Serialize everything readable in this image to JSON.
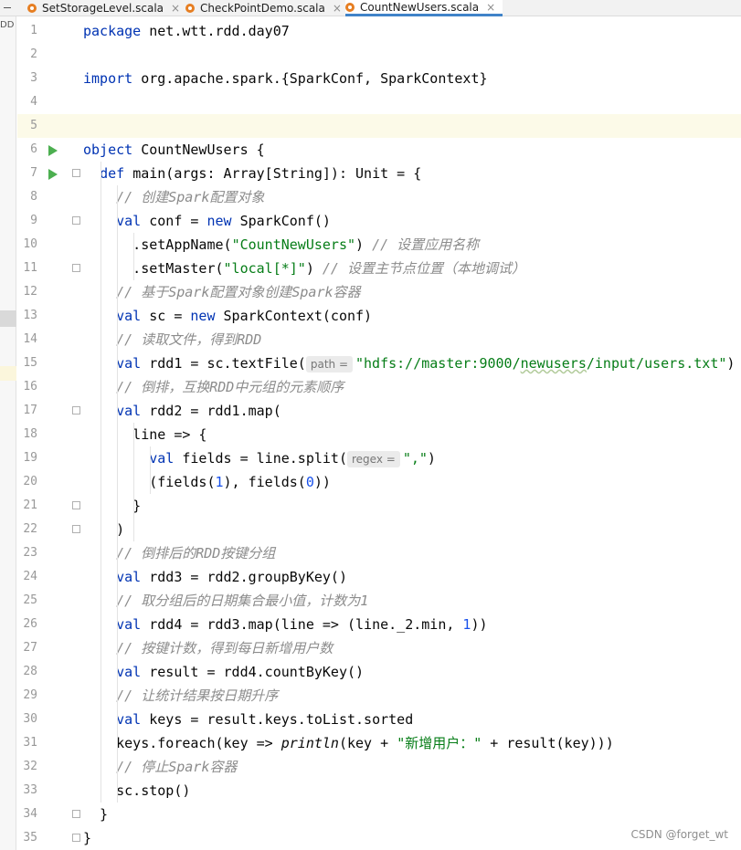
{
  "tabs": [
    {
      "label": "SetStorageLevel.scala",
      "active": false
    },
    {
      "label": "CheckPointDemo.scala",
      "active": false
    },
    {
      "label": "CountNewUsers.scala",
      "active": true
    }
  ],
  "tab_close_glyph": "×",
  "sidebar": {
    "label": "DD"
  },
  "editor": {
    "lines": [
      {
        "n": "1",
        "tokens": [
          {
            "t": "package ",
            "c": "kw"
          },
          {
            "t": "net.wtt.rdd.day07"
          }
        ]
      },
      {
        "n": "2",
        "tokens": []
      },
      {
        "n": "3",
        "tokens": [
          {
            "t": "import ",
            "c": "kw"
          },
          {
            "t": "org.apache.spark.{SparkConf, SparkContext}"
          }
        ]
      },
      {
        "n": "4",
        "tokens": []
      },
      {
        "n": "5",
        "tokens": [],
        "caret": true
      },
      {
        "n": "6",
        "run": true,
        "tokens": [
          {
            "t": "object ",
            "c": "kw"
          },
          {
            "t": "CountNewUsers {"
          }
        ]
      },
      {
        "n": "7",
        "run": true,
        "fold": true,
        "tokens": [
          {
            "t": "  "
          },
          {
            "t": "def ",
            "c": "kw"
          },
          {
            "t": "main(args: Array[String]): Unit = {"
          }
        ]
      },
      {
        "n": "8",
        "tokens": [
          {
            "t": "    "
          },
          {
            "t": "// 创建Spark配置对象",
            "c": "cmt"
          }
        ]
      },
      {
        "n": "9",
        "fold": true,
        "tokens": [
          {
            "t": "    "
          },
          {
            "t": "val ",
            "c": "kw"
          },
          {
            "t": "conf = "
          },
          {
            "t": "new ",
            "c": "kw"
          },
          {
            "t": "SparkConf()"
          }
        ]
      },
      {
        "n": "10",
        "tokens": [
          {
            "t": "      .setAppName("
          },
          {
            "t": "\"CountNewUsers\"",
            "c": "str"
          },
          {
            "t": ") "
          },
          {
            "t": "// 设置应用名称",
            "c": "cmt"
          }
        ]
      },
      {
        "n": "11",
        "fold": true,
        "tokens": [
          {
            "t": "      .setMaster("
          },
          {
            "t": "\"local[*]\"",
            "c": "str"
          },
          {
            "t": ") "
          },
          {
            "t": "// 设置主节点位置（本地调试）",
            "c": "cmt"
          }
        ]
      },
      {
        "n": "12",
        "tokens": [
          {
            "t": "    "
          },
          {
            "t": "// 基于Spark配置对象创建Spark容器",
            "c": "cmt"
          }
        ]
      },
      {
        "n": "13",
        "tokens": [
          {
            "t": "    "
          },
          {
            "t": "val ",
            "c": "kw"
          },
          {
            "t": "sc = "
          },
          {
            "t": "new ",
            "c": "kw"
          },
          {
            "t": "SparkContext(conf)"
          }
        ]
      },
      {
        "n": "14",
        "tokens": [
          {
            "t": "    "
          },
          {
            "t": "// 读取文件，得到RDD",
            "c": "cmt"
          }
        ]
      },
      {
        "n": "15",
        "tokens": [
          {
            "t": "    "
          },
          {
            "t": "val ",
            "c": "kw"
          },
          {
            "t": "rdd1 = sc.textFile("
          },
          {
            "t": "path =",
            "c": "hint"
          },
          {
            "t": "\"hdfs://master:9000/",
            "c": "str"
          },
          {
            "t": "newusers",
            "c": "str sq"
          },
          {
            "t": "/input/users.txt\"",
            "c": "str"
          },
          {
            "t": ")"
          }
        ]
      },
      {
        "n": "16",
        "tokens": [
          {
            "t": "    "
          },
          {
            "t": "// 倒排，互换RDD中元组的元素顺序",
            "c": "cmt"
          }
        ]
      },
      {
        "n": "17",
        "fold": true,
        "tokens": [
          {
            "t": "    "
          },
          {
            "t": "val ",
            "c": "kw"
          },
          {
            "t": "rdd2 = rdd1.map("
          }
        ]
      },
      {
        "n": "18",
        "tokens": [
          {
            "t": "      line => {"
          }
        ]
      },
      {
        "n": "19",
        "tokens": [
          {
            "t": "        "
          },
          {
            "t": "val ",
            "c": "kw"
          },
          {
            "t": "fields = line.split("
          },
          {
            "t": "regex =",
            "c": "hint"
          },
          {
            "t": "\",\"",
            "c": "str"
          },
          {
            "t": ")"
          }
        ]
      },
      {
        "n": "20",
        "tokens": [
          {
            "t": "        (fields("
          },
          {
            "t": "1",
            "c": "num"
          },
          {
            "t": "), fields("
          },
          {
            "t": "0",
            "c": "num"
          },
          {
            "t": "))"
          }
        ]
      },
      {
        "n": "21",
        "fold": true,
        "tokens": [
          {
            "t": "      }"
          }
        ]
      },
      {
        "n": "22",
        "fold": true,
        "tokens": [
          {
            "t": "    )"
          }
        ]
      },
      {
        "n": "23",
        "tokens": [
          {
            "t": "    "
          },
          {
            "t": "// 倒排后的RDD按键分组",
            "c": "cmt"
          }
        ]
      },
      {
        "n": "24",
        "tokens": [
          {
            "t": "    "
          },
          {
            "t": "val ",
            "c": "kw"
          },
          {
            "t": "rdd3 = rdd2.groupByKey()"
          }
        ]
      },
      {
        "n": "25",
        "tokens": [
          {
            "t": "    "
          },
          {
            "t": "// 取分组后的日期集合最小值，计数为1",
            "c": "cmt"
          }
        ]
      },
      {
        "n": "26",
        "tokens": [
          {
            "t": "    "
          },
          {
            "t": "val ",
            "c": "kw"
          },
          {
            "t": "rdd4 = rdd3.map(line => (line._2.min, "
          },
          {
            "t": "1",
            "c": "num"
          },
          {
            "t": "))"
          }
        ]
      },
      {
        "n": "27",
        "tokens": [
          {
            "t": "    "
          },
          {
            "t": "// 按键计数，得到每日新增用户数",
            "c": "cmt"
          }
        ]
      },
      {
        "n": "28",
        "tokens": [
          {
            "t": "    "
          },
          {
            "t": "val ",
            "c": "kw"
          },
          {
            "t": "result = rdd4.countByKey()"
          }
        ]
      },
      {
        "n": "29",
        "tokens": [
          {
            "t": "    "
          },
          {
            "t": "// 让统计结果按日期升序",
            "c": "cmt"
          }
        ]
      },
      {
        "n": "30",
        "tokens": [
          {
            "t": "    "
          },
          {
            "t": "val ",
            "c": "kw"
          },
          {
            "t": "keys = result.keys.toList.sorted"
          }
        ]
      },
      {
        "n": "31",
        "tokens": [
          {
            "t": "    keys.foreach(key => "
          },
          {
            "t": "println",
            "c": "fn"
          },
          {
            "t": "(key + "
          },
          {
            "t": "\"新增用户：\"",
            "c": "str"
          },
          {
            "t": " + result(key)))"
          }
        ]
      },
      {
        "n": "32",
        "tokens": [
          {
            "t": "    "
          },
          {
            "t": "// 停止Spark容器",
            "c": "cmt"
          }
        ]
      },
      {
        "n": "33",
        "tokens": [
          {
            "t": "    sc.stop()"
          }
        ]
      },
      {
        "n": "34",
        "fold": true,
        "tokens": [
          {
            "t": "  }"
          }
        ]
      },
      {
        "n": "35",
        "fold": true,
        "tokens": [
          {
            "t": "}"
          }
        ]
      }
    ]
  },
  "watermark": "CSDN @forget_wt",
  "colors": {
    "keyword": "#0033b3",
    "string": "#067d17",
    "number": "#1750eb",
    "comment": "#8c8c8c",
    "run": "#4caf50",
    "active_tab": "#4083c9"
  }
}
